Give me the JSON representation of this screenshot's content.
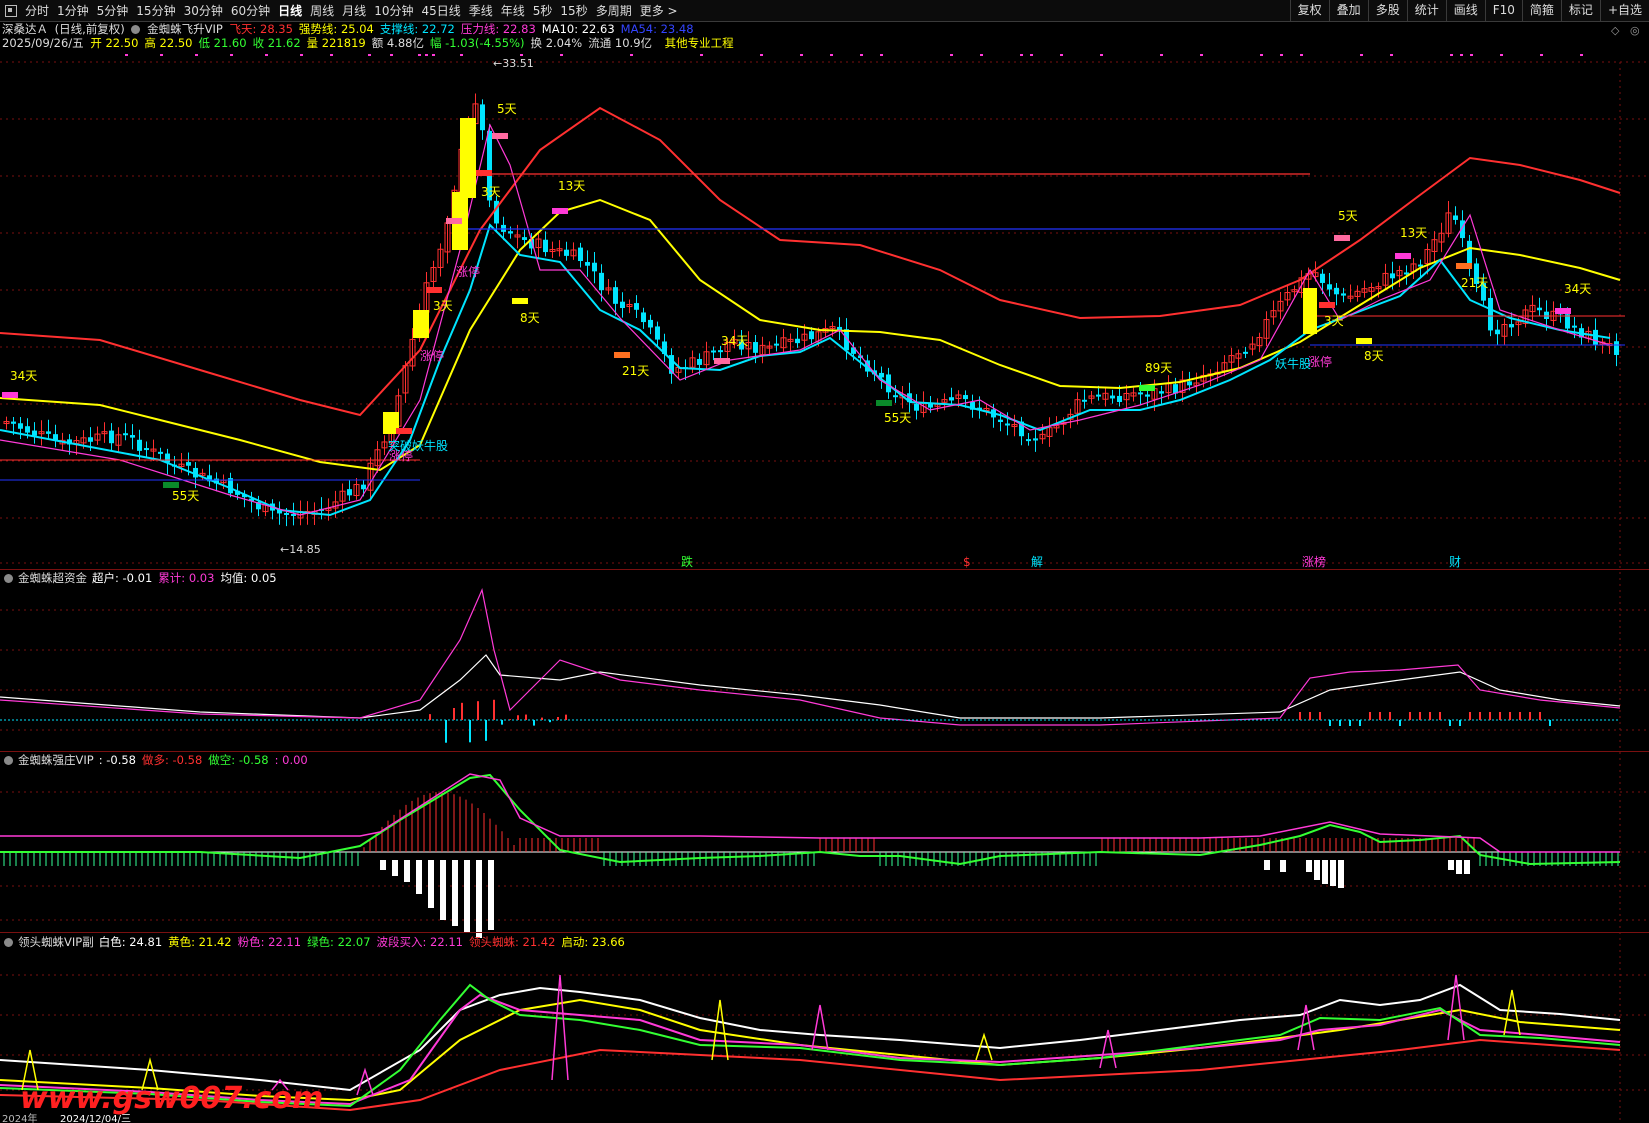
{
  "toolbar": {
    "timeframes": [
      "分时",
      "1分钟",
      "5分钟",
      "15分钟",
      "30分钟",
      "60分钟",
      "日线",
      "周线",
      "月线",
      "10分钟",
      "45日线",
      "季线",
      "年线",
      "5秒",
      "15秒",
      "多周期",
      "更多 >"
    ],
    "active_index": 6,
    "tools": [
      "复权",
      "叠加",
      "多股",
      "统计",
      "画线",
      "F10",
      "简箍",
      "标记",
      "+自选"
    ]
  },
  "header": {
    "stock_name": "深桑达Ａ",
    "mode": "(日线,前复权)",
    "indicator_name": "金蜘蛛飞升VIP",
    "items": [
      {
        "label": "飞天:",
        "value": "28.35",
        "color": "#ff3030"
      },
      {
        "label": "强势线:",
        "value": "25.04",
        "color": "#ffff00"
      },
      {
        "label": "支撑线:",
        "value": "22.72",
        "color": "#00e5ff"
      },
      {
        "label": "压力线:",
        "value": "22.83",
        "color": "#ff3ad7"
      },
      {
        "label": "MA10:",
        "value": "22.63",
        "color": "#ffffff"
      },
      {
        "label": "MA54:",
        "value": "23.48",
        "color": "#3344ff"
      }
    ]
  },
  "ohlc": {
    "date": "2025/09/26/五",
    "items": [
      {
        "label": "开",
        "value": "22.50",
        "color": "#ffff00"
      },
      {
        "label": "高",
        "value": "22.50",
        "color": "#ffff00"
      },
      {
        "label": "低",
        "value": "21.60",
        "color": "#33ff33"
      },
      {
        "label": "收",
        "value": "21.62",
        "color": "#33ff33"
      },
      {
        "label": "量",
        "value": "221819",
        "color": "#ffff00"
      },
      {
        "label": "额",
        "value": "4.88亿",
        "color": "#dddddd"
      },
      {
        "label": "幅",
        "value": "-1.03(-4.55%)",
        "color": "#33ff33"
      },
      {
        "label": "换",
        "value": "2.04%",
        "color": "#dddddd"
      },
      {
        "label": "流通",
        "value": "10.9亿",
        "color": "#dddddd"
      }
    ],
    "extra": "其他专业工程"
  },
  "annotations": {
    "high": "33.51",
    "low": "14.85",
    "day_labels": [
      {
        "text": "34天",
        "color": "#ffff00"
      },
      {
        "text": "55天",
        "color": "#ffff00"
      },
      {
        "text": "3天",
        "color": "#ffff00"
      },
      {
        "text": "5天",
        "color": "#ffff00"
      },
      {
        "text": "3天",
        "color": "#ffff00"
      },
      {
        "text": "8天",
        "color": "#ffff00"
      },
      {
        "text": "13天",
        "color": "#ffff00"
      },
      {
        "text": "21天",
        "color": "#ffff00"
      },
      {
        "text": "34天",
        "color": "#ffff00"
      },
      {
        "text": "55天",
        "color": "#ffff00"
      },
      {
        "text": "89天",
        "color": "#ffff00"
      },
      {
        "text": "5天",
        "color": "#ffff00"
      },
      {
        "text": "13天",
        "color": "#ffff00"
      },
      {
        "text": "3天",
        "color": "#ffff00"
      },
      {
        "text": "8天",
        "color": "#ffff00"
      },
      {
        "text": "21天",
        "color": "#ffff00"
      },
      {
        "text": "34天",
        "color": "#ffff00"
      }
    ],
    "tags": [
      {
        "text": "涨停",
        "color": "#ff3ad7"
      },
      {
        "text": "涨停",
        "color": "#ff3ad7"
      },
      {
        "text": "涨停",
        "color": "#ff3ad7"
      },
      {
        "text": "突破妖牛股",
        "color": "#00e5ff"
      },
      {
        "text": "涨停",
        "color": "#ff3ad7"
      },
      {
        "text": "妖牛股",
        "color": "#00e5ff"
      }
    ],
    "events": [
      {
        "text": "跌",
        "color": "#33ff33"
      },
      {
        "text": "$",
        "color": "#ff3030"
      },
      {
        "text": "解",
        "color": "#00e5ff"
      },
      {
        "text": "涨榜",
        "color": "#ff3ad7"
      },
      {
        "text": "财",
        "color": "#00e5ff"
      }
    ]
  },
  "panel1": {
    "name": "金蜘蛛超资金",
    "items": [
      {
        "label": "超户:",
        "value": "-0.01",
        "color": "#ffffff"
      },
      {
        "label": "累计:",
        "value": "0.03",
        "color": "#ff3ad7"
      },
      {
        "label": "均值:",
        "value": "0.05",
        "color": "#ffffff"
      }
    ]
  },
  "panel2": {
    "name": "金蜘蛛强庄VIP",
    "items": [
      {
        "label": ":",
        "value": "-0.58",
        "color": "#ffffff"
      },
      {
        "label": "做多:",
        "value": "-0.58",
        "color": "#ff3030"
      },
      {
        "label": "做空:",
        "value": "-0.58",
        "color": "#33ff33"
      },
      {
        "label": ":",
        "value": "0.00",
        "color": "#ff3ad7"
      }
    ]
  },
  "panel3": {
    "name": "领头蜘蛛VIP副",
    "items": [
      {
        "label": "白色:",
        "value": "24.81",
        "color": "#ffffff"
      },
      {
        "label": "黄色:",
        "value": "21.42",
        "color": "#ffff00"
      },
      {
        "label": "粉色:",
        "value": "22.11",
        "color": "#ff3ad7"
      },
      {
        "label": "绿色:",
        "value": "22.07",
        "color": "#33ff33"
      },
      {
        "label": "波段买入:",
        "value": "22.11",
        "color": "#ff3ad7"
      },
      {
        "label": "领头蜘蛛:",
        "value": "21.42",
        "color": "#ff3030"
      },
      {
        "label": "启动:",
        "value": "23.66",
        "color": "#ffff00"
      }
    ]
  },
  "watermark": "www.gsw007.com",
  "bottom_date": "2024/12/04/三",
  "bottom_year": "2024年",
  "colors": {
    "up": "#ff3030",
    "down": "#00e5ff",
    "yellow": "#ffff00",
    "magenta": "#ff3ad7",
    "green": "#33ff33",
    "grid": "#7a1010"
  }
}
